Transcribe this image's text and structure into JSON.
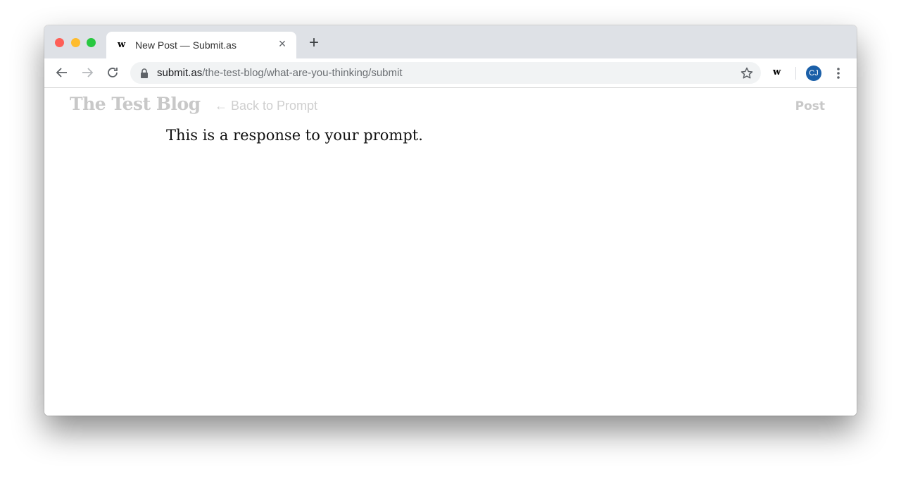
{
  "browser": {
    "tab": {
      "favicon": "w",
      "title": "New Post — Submit.as",
      "close_icon": "×"
    },
    "new_tab_icon": "+",
    "url": {
      "host": "submit.as",
      "path": "/the-test-blog/what-are-you-thinking/submit"
    },
    "extension_label": "w",
    "profile_initials": "CJ",
    "profile_color": "#1a5fa8"
  },
  "page": {
    "blog_title": "The Test Blog",
    "back_link": "← Back to Prompt",
    "post_button": "Post",
    "editor_text": "This is a response to your prompt."
  }
}
